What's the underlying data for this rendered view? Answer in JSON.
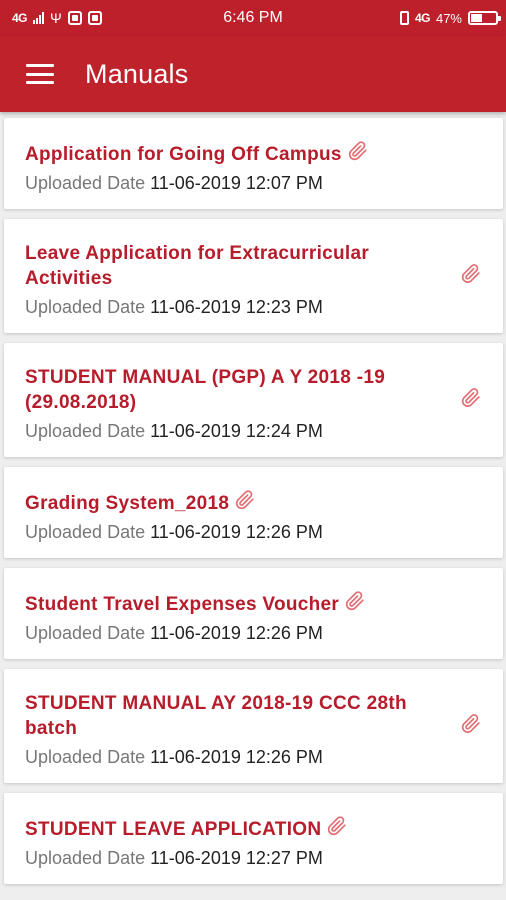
{
  "status_bar": {
    "network": "4G",
    "time": "6:46 PM",
    "network_right": "4G",
    "battery_percent": "47%",
    "battery_level": 0.47
  },
  "app_bar": {
    "menu_icon": "hamburger-menu-icon",
    "title": "Manuals"
  },
  "colors": {
    "primary": "#c0222c",
    "title_text": "#b71c2b",
    "attachment_icon": "#e26d72"
  },
  "manuals": [
    {
      "title": "Application for Going Off Campus",
      "date_label": "Uploaded Date",
      "date": "11-06-2019 12:07 PM",
      "attachment_icon": "paperclip-icon"
    },
    {
      "title": "Leave Application for Extracurricular Activities",
      "date_label": "Uploaded Date",
      "date": "11-06-2019 12:23 PM",
      "attachment_icon": "paperclip-icon"
    },
    {
      "title": "STUDENT MANUAL (PGP) A Y 2018 -19 (29.08.2018)",
      "date_label": "Uploaded Date",
      "date": "11-06-2019 12:24 PM",
      "attachment_icon": "paperclip-icon"
    },
    {
      "title": "Grading System_2018",
      "date_label": "Uploaded Date",
      "date": "11-06-2019 12:26 PM",
      "attachment_icon": "paperclip-icon"
    },
    {
      "title": "Student Travel Expenses Voucher",
      "date_label": "Uploaded Date",
      "date": "11-06-2019 12:26 PM",
      "attachment_icon": "paperclip-icon"
    },
    {
      "title": "STUDENT MANUAL AY 2018-19 CCC 28th batch",
      "date_label": "Uploaded Date",
      "date": "11-06-2019 12:26 PM",
      "attachment_icon": "paperclip-icon"
    },
    {
      "title": "STUDENT LEAVE APPLICATION",
      "date_label": "Uploaded Date",
      "date": "11-06-2019 12:27 PM",
      "attachment_icon": "paperclip-icon"
    }
  ]
}
